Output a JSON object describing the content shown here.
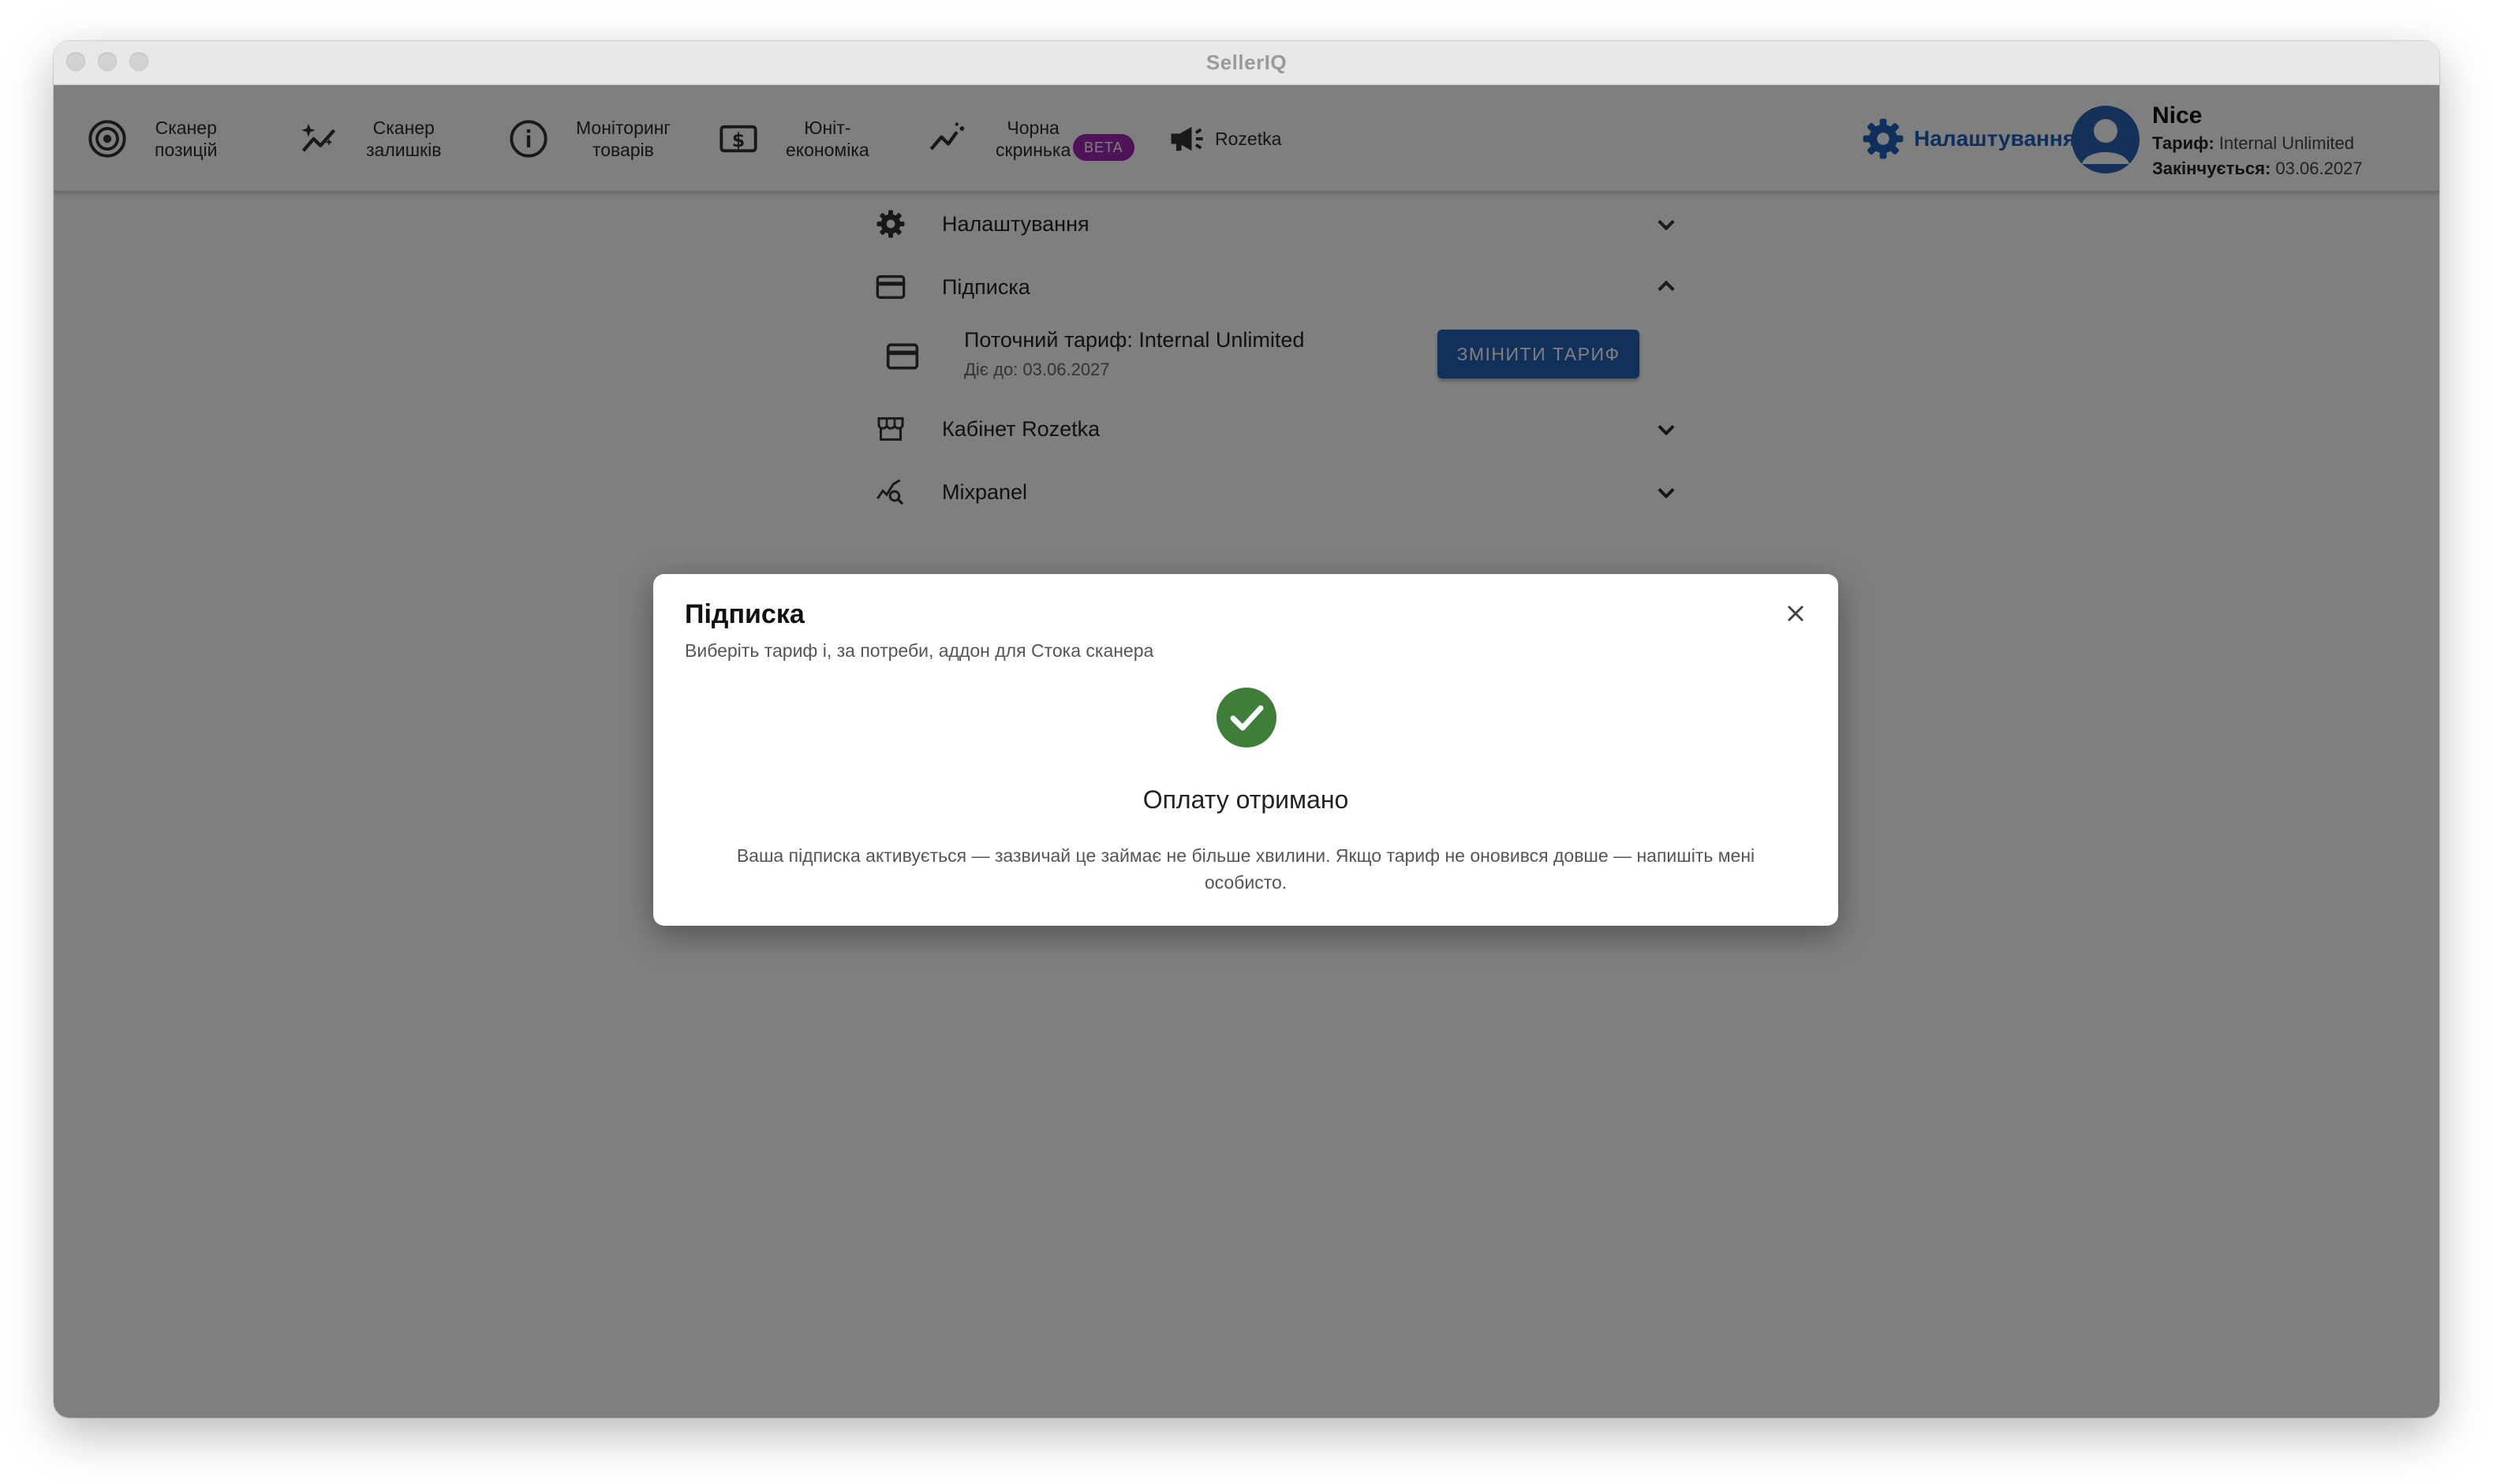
{
  "window": {
    "title": "SellerIQ"
  },
  "nav": [
    {
      "label": "Сканер\nпозицій",
      "icon": "target-icon"
    },
    {
      "label": "Сканер\nзалишків",
      "icon": "sparkle-chart-icon"
    },
    {
      "label": "Моніторинг\nтоварів",
      "icon": "info-circle-icon"
    },
    {
      "label": "Юніт-\nекономіка",
      "icon": "dollar-box-icon"
    },
    {
      "label": "Чорна\nскринька",
      "icon": "trend-line-icon",
      "badge": "BETA"
    },
    {
      "label": "Rozetka",
      "icon": "megaphone-icon"
    }
  ],
  "header": {
    "settings_label": "Налаштування",
    "user_name": "Nice",
    "plan_key": "Тариф:",
    "plan_value": "Internal Unlimited",
    "expires_key": "Закінчується:",
    "expires_value": "03.06.2027"
  },
  "settings_panel": {
    "sections": [
      {
        "label": "Налаштування",
        "icon": "gear-icon",
        "expanded": false
      },
      {
        "label": "Підписка",
        "icon": "credit-card-icon",
        "expanded": true
      },
      {
        "label": "Кабінет Rozetka",
        "icon": "storefront-icon",
        "expanded": false
      },
      {
        "label": "Mixpanel",
        "icon": "query-stats-icon",
        "expanded": false
      }
    ],
    "subscription": {
      "current_plan": "Поточний тариф: Internal Unlimited",
      "valid_until": "Діє до: 03.06.2027",
      "change_button": "ЗМІНИТИ ТАРИФ"
    }
  },
  "dialog": {
    "title": "Підписка",
    "subtitle": "Виберіть тариф і, за потреби, аддон для Стока сканера",
    "status_title": "Оплату отримано",
    "status_text": "Ваша підписка активується — зазвичай це займає не більше хвилини. Якщо тариф не оновився довше — напишіть мені особисто."
  },
  "colors": {
    "accent": "#2460b8",
    "beta_badge": "#9c27b0",
    "success": "#3f7d3b",
    "overlay": "rgba(0,0,0,0.5)"
  }
}
